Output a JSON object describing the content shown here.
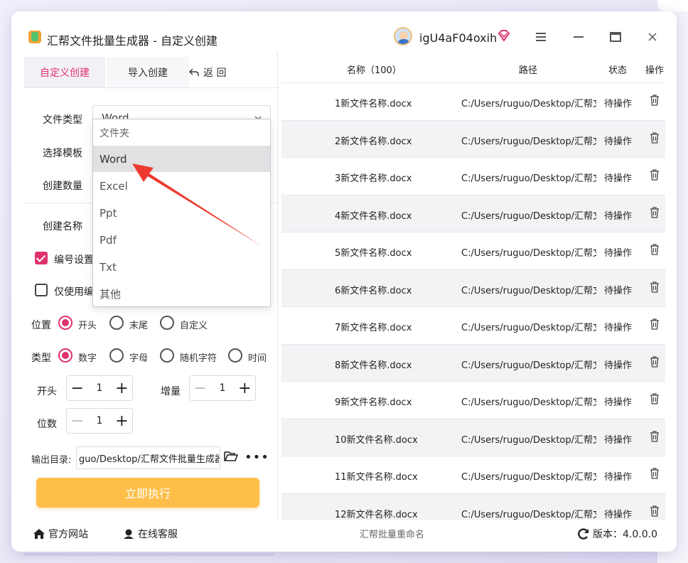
{
  "app": {
    "title": "汇帮文件批量生成器 - 自定义创建",
    "username": "igU4aF04oxih"
  },
  "left": {
    "tabs": [
      "自定义创建",
      "导入创建"
    ],
    "back_label": "返 回",
    "file_type_label": "文件类型",
    "file_type_value": "Word",
    "template_label": "选择模板",
    "count_label": "创建数量",
    "name_label": "创建名称",
    "numbering_label": "编号设置",
    "only_label": "仅使用编",
    "position_label": "位置",
    "position_options": [
      "开头",
      "末尾",
      "自定义"
    ],
    "type_label": "类型",
    "type_options": [
      "数字",
      "字母",
      "随机字符",
      "时间"
    ],
    "start_label": "开头",
    "start_value": "1",
    "increment_label": "增量",
    "increment_value": "1",
    "digits_label": "位数",
    "digits_value": "1",
    "output_label": "输出目录:",
    "output_value": "guo/Desktop/汇帮文件批量生成器",
    "run_label": "立即执行"
  },
  "dropdown": {
    "options": [
      "文件夹",
      "Word",
      "Excel",
      "Ppt",
      "Pdf",
      "Txt",
      "其他"
    ],
    "selected": "Word"
  },
  "table": {
    "headers": [
      "名称（100）",
      "路径",
      "状态",
      "操作"
    ],
    "rows": [
      {
        "name": "1新文件名称.docx",
        "path": "C:/Users/ruguo/Desktop/汇帮文",
        "status": "待操作"
      },
      {
        "name": "2新文件名称.docx",
        "path": "C:/Users/ruguo/Desktop/汇帮文",
        "status": "待操作"
      },
      {
        "name": "3新文件名称.docx",
        "path": "C:/Users/ruguo/Desktop/汇帮文",
        "status": "待操作"
      },
      {
        "name": "4新文件名称.docx",
        "path": "C:/Users/ruguo/Desktop/汇帮文",
        "status": "待操作"
      },
      {
        "name": "5新文件名称.docx",
        "path": "C:/Users/ruguo/Desktop/汇帮文",
        "status": "待操作"
      },
      {
        "name": "6新文件名称.docx",
        "path": "C:/Users/ruguo/Desktop/汇帮文",
        "status": "待操作"
      },
      {
        "name": "7新文件名称.docx",
        "path": "C:/Users/ruguo/Desktop/汇帮文",
        "status": "待操作"
      },
      {
        "name": "8新文件名称.docx",
        "path": "C:/Users/ruguo/Desktop/汇帮文",
        "status": "待操作"
      },
      {
        "name": "9新文件名称.docx",
        "path": "C:/Users/ruguo/Desktop/汇帮文",
        "status": "待操作"
      },
      {
        "name": "10新文件名称.docx",
        "path": "C:/Users/ruguo/Desktop/汇帮文",
        "status": "待操作"
      },
      {
        "name": "11新文件名称.docx",
        "path": "C:/Users/ruguo/Desktop/汇帮文",
        "status": "待操作"
      },
      {
        "name": "12新文件名称.docx",
        "path": "C:/Users/ruguo/Desktop/汇帮文",
        "status": "待操作"
      }
    ]
  },
  "footer": {
    "website": "官方网站",
    "support": "在线客服",
    "center": "汇帮批量重命名",
    "version": "版本：4.0.0.0"
  },
  "colors": {
    "accent": "#e0336b",
    "run_button": "#fdbf4a",
    "arrow": "#ee3a2e"
  }
}
